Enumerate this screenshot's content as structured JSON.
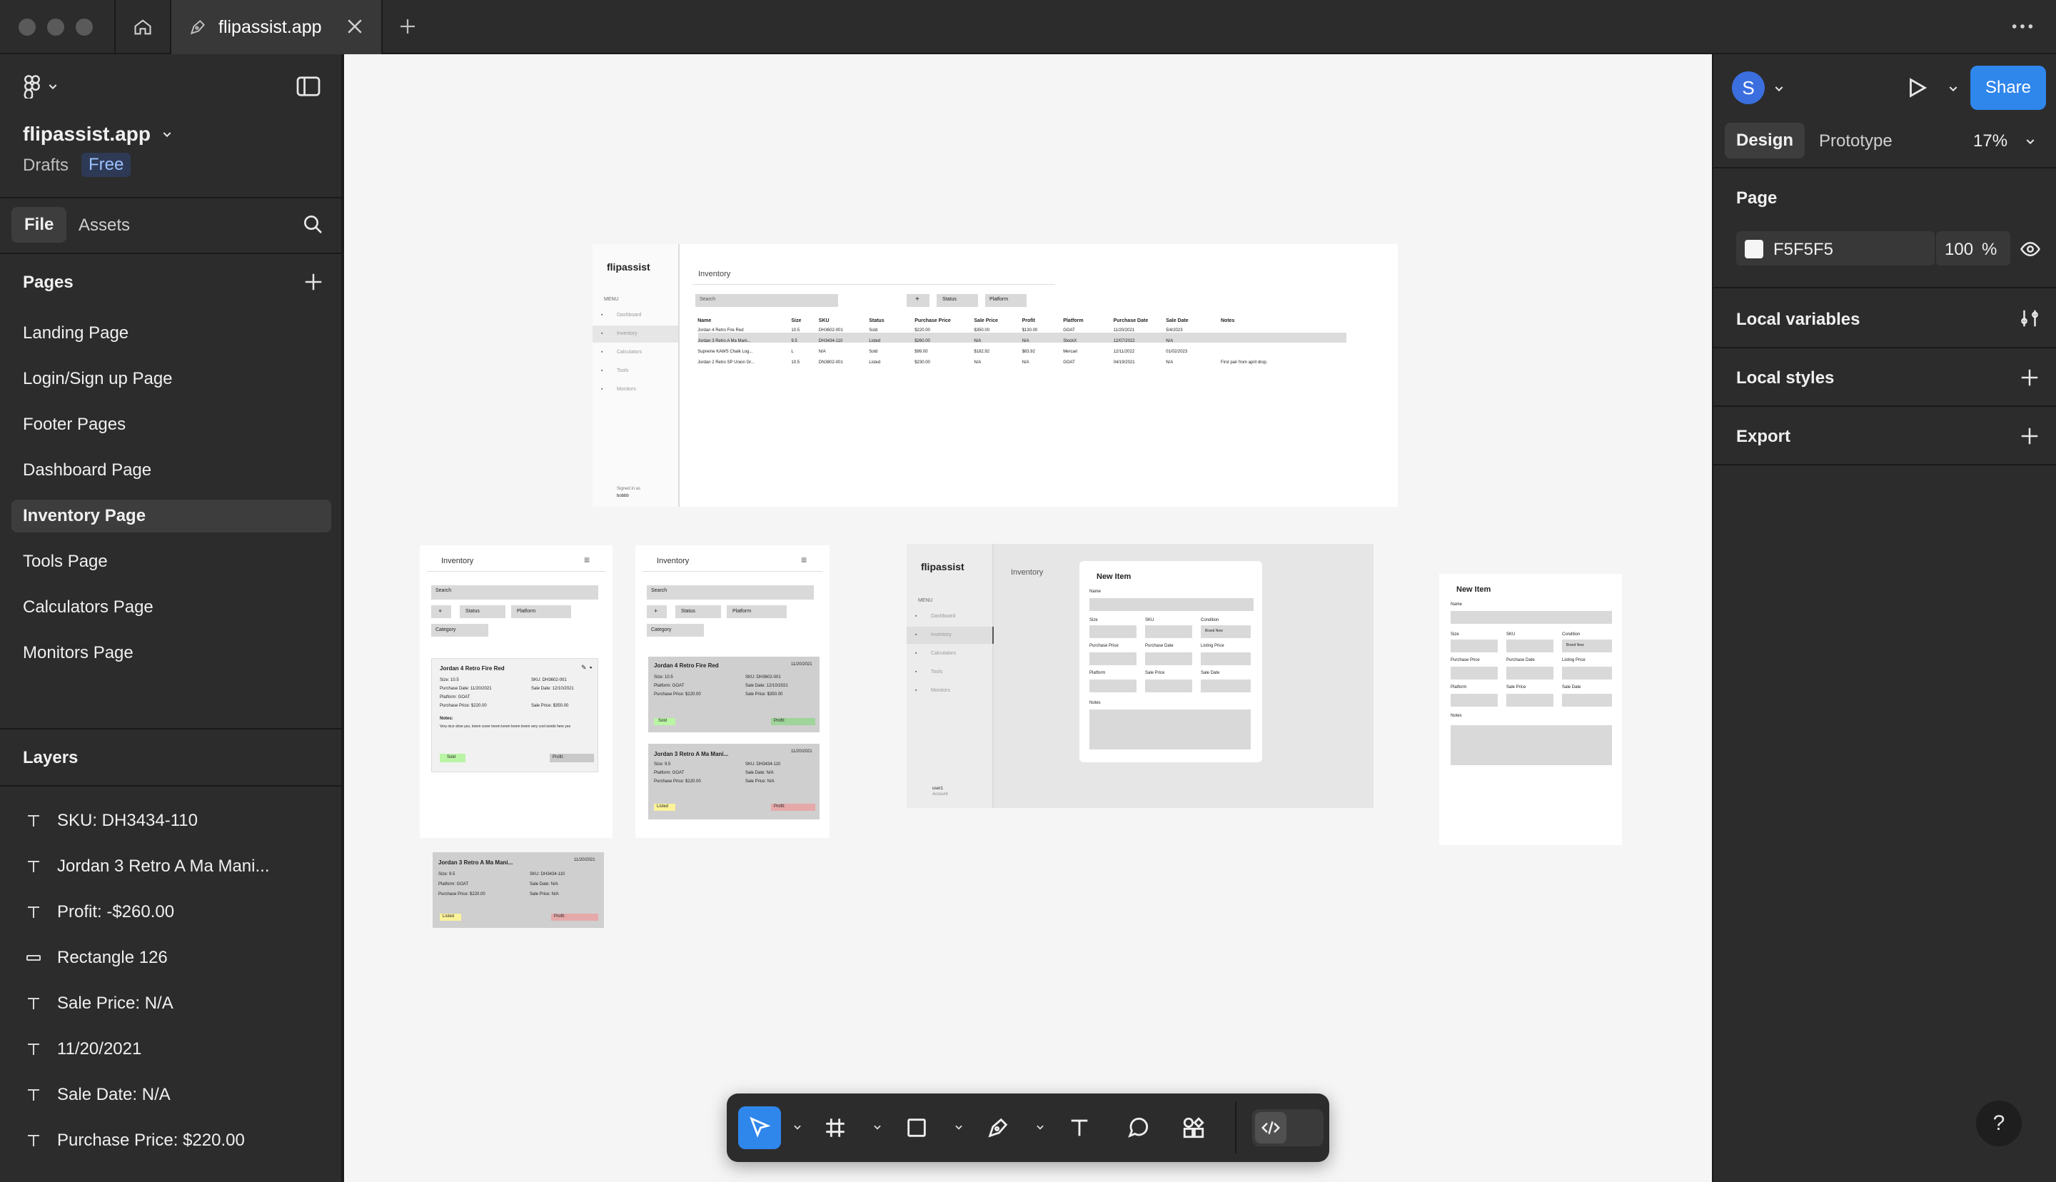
{
  "window": {
    "tab_title": "flipassist.app"
  },
  "left_panel": {
    "file_name": "flipassist.app",
    "location": "Drafts",
    "plan_badge": "Free",
    "tabs": [
      "File",
      "Assets"
    ],
    "pages_title": "Pages",
    "pages": [
      {
        "label": "Landing Page",
        "active": false
      },
      {
        "label": "Login/Sign up Page",
        "active": false
      },
      {
        "label": "Footer Pages",
        "active": false
      },
      {
        "label": "Dashboard Page",
        "active": false
      },
      {
        "label": "Inventory Page",
        "active": true
      },
      {
        "label": "Tools Page",
        "active": false
      },
      {
        "label": "Calculators Page",
        "active": false
      },
      {
        "label": "Monitors Page",
        "active": false
      }
    ],
    "layers_title": "Layers",
    "layers": [
      {
        "label": "SKU: DH3434-110",
        "icon": "text-icon"
      },
      {
        "label": "Jordan 3 Retro A Ma Mani...",
        "icon": "text-icon"
      },
      {
        "label": "Profit: -$260.00",
        "icon": "text-icon"
      },
      {
        "label": "Rectangle 126",
        "icon": "rectangle-icon"
      },
      {
        "label": "Sale Price: N/A",
        "icon": "text-icon"
      },
      {
        "label": "11/20/2021",
        "icon": "text-icon"
      },
      {
        "label": "Sale Date: N/A",
        "icon": "text-icon"
      },
      {
        "label": "Purchase Price: $220.00",
        "icon": "text-icon"
      }
    ]
  },
  "right_panel": {
    "avatar_letter": "S",
    "share_label": "Share",
    "tabs": [
      "Design",
      "Prototype"
    ],
    "zoom": "17%",
    "page_section": "Page",
    "page_color": "F5F5F5",
    "page_opacity": "100",
    "percent_sign": "%",
    "local_variables": "Local variables",
    "local_styles": "Local styles",
    "export": "Export"
  },
  "canvas": {
    "desktop": {
      "logo": "flipassist",
      "menu_label": "MENU",
      "nav": [
        "Dashboard",
        "Inventory",
        "Calculators",
        "Tools",
        "Monitors"
      ],
      "signed_in": "Signed in as",
      "username": "bobbb",
      "heading": "Inventory",
      "search_placeholder": "Search",
      "add": "+",
      "status_filter": "Status",
      "platform_filter": "Platform",
      "columns": [
        "Name",
        "Size",
        "SKU",
        "Status",
        "Purchase Price",
        "Sale Price",
        "Profit",
        "Platform",
        "Purchase Date",
        "Sale Date",
        "Notes"
      ],
      "rows": [
        [
          "Jordan 4 Retro Fire Red",
          "10.5",
          "DH3602-001",
          "Sold",
          "$220.00",
          "$350.00",
          "$130.00",
          "GOAT",
          "11/20/2021",
          "5/4/2023",
          ""
        ],
        [
          "Jordan 3 Retro A Ma Mani...",
          "9.5",
          "DH3434-110",
          "Listed",
          "$260.00",
          "N/A",
          "N/A",
          "StockX",
          "12/07/2022",
          "N/A",
          ""
        ],
        [
          "Supreme KAWS Chalk Log...",
          "L",
          "N/A",
          "Sold",
          "$99.00",
          "$182.92",
          "$83.92",
          "Mercari",
          "12/11/2022",
          "01/02/2023",
          ""
        ],
        [
          "Jordan 2 Retro SP Union Gr...",
          "10.5",
          "DN3802-001",
          "Listed",
          "$230.00",
          "N/A",
          "N/A",
          "GOAT",
          "04/19/2021",
          "N/A",
          "First pair from april drop."
        ]
      ]
    },
    "mobile": {
      "heading": "Inventory",
      "search_placeholder": "Search",
      "status_filter": "Status",
      "platform_filter": "Platform",
      "category_filter": "Category",
      "card1": {
        "name": "Jordan 4 Retro Fire Red",
        "date": "11/20/2021",
        "size": "Size: 10.5",
        "sku": "SKU: DH3602-001",
        "purchase_date": "Purchase Date: 11/20/2021",
        "sale_date": "Sale Date: 12/10/2021",
        "platform": "Platform: GOAT",
        "purchase_price": "Purchase Price: $220.00",
        "sale_price": "Sale Price: $350.00",
        "notes_label": "Notes:",
        "notes": "Very nice shoe yes, lorem cover lorem lorem lorem lorem very cool words here yes",
        "status": "Sold",
        "profit": "Profit:"
      },
      "card2": {
        "name": "Jordan 3 Retro A Ma Mani...",
        "date": "11/20/2021",
        "size": "Size: 9.5",
        "sku": "SKU: DH3434-110",
        "platform": "Platform: GOAT",
        "sale_date": "Sale Date: N/A",
        "purchase_price": "Purchase Price: $220.00",
        "sale_price": "Sale Price: N/A",
        "status": "Listed",
        "profit": "Profit:"
      }
    },
    "new_item": {
      "title": "New Item",
      "name": "Name",
      "size": "Size",
      "sku": "SKU",
      "condition": "Condition",
      "condition_value": "Brand New",
      "purchase_price": "Purchase Price",
      "purchase_date": "Purchase Date",
      "listing_price": "Listing Price",
      "platform": "Platform",
      "sale_price": "Sale Price",
      "sale_date": "Sale Date",
      "notes": "Notes"
    },
    "modal_user": "user1",
    "modal_user_sub": "Account"
  }
}
